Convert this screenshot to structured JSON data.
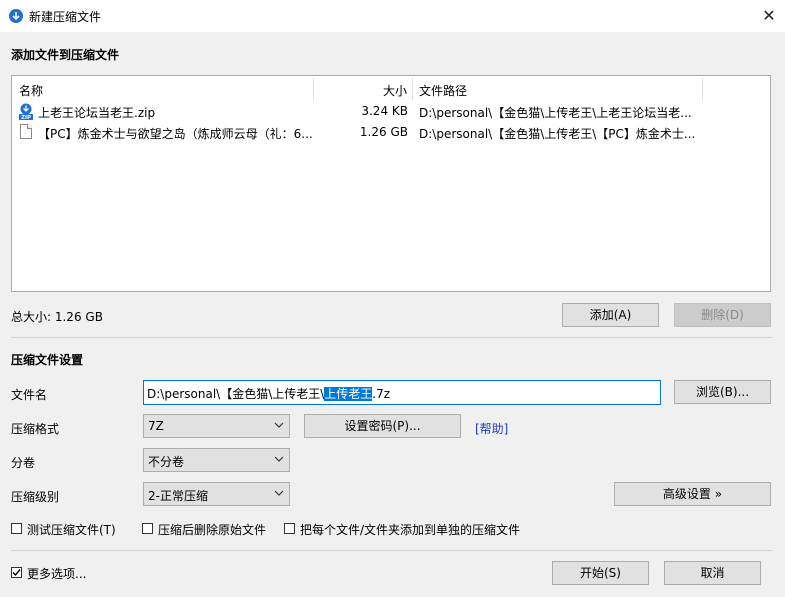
{
  "window": {
    "title": "新建压缩文件",
    "close_glyph": "✕"
  },
  "add_section": {
    "title": "添加文件到压缩文件"
  },
  "file_list": {
    "columns": {
      "name": "名称",
      "size": "大小",
      "path": "文件路径"
    },
    "rows": [
      {
        "icon": "zip-file-icon",
        "name": "上老王论坛当老王.zip",
        "size": "3.24 KB",
        "path": "D:\\personal\\【金色猫\\上传老王\\上老王论坛当老..."
      },
      {
        "icon": "document-icon",
        "name": "【PC】炼金术士与欲望之岛（炼成师云母（礼：6...",
        "size": "1.26 GB",
        "path": "D:\\personal\\【金色猫\\上传老王\\【PC】炼金术士..."
      }
    ]
  },
  "total_size": "总大小: 1.26 GB",
  "buttons": {
    "add": "添加(A)",
    "delete": "删除(D)",
    "browse": "浏览(B)...",
    "set_password": "设置密码(P)...",
    "help": "[帮助]",
    "advanced": "高级设置 »",
    "start": "开始(S)",
    "cancel": "取消"
  },
  "settings": {
    "title": "压缩文件设置",
    "filename_label": "文件名",
    "filename_prefix": "D:\\personal\\【金色猫\\上传老王\\",
    "filename_selected": "上传老王",
    "filename_suffix": ".7z",
    "format_label": "压缩格式",
    "format_value": "7Z",
    "volume_label": "分卷",
    "volume_value": "不分卷",
    "level_label": "压缩级别",
    "level_value": "2-正常压缩"
  },
  "checkboxes": {
    "test": {
      "label": "测试压缩文件(T)",
      "checked": false
    },
    "delete_source": {
      "label": "压缩后删除原始文件",
      "checked": false
    },
    "separate": {
      "label": "把每个文件/文件夹添加到单独的压缩文件",
      "checked": false
    },
    "more_options": {
      "label": "更多选项...",
      "checked": true
    }
  },
  "colors": {
    "accent": "#0078d7",
    "link": "#1a3fbf"
  }
}
